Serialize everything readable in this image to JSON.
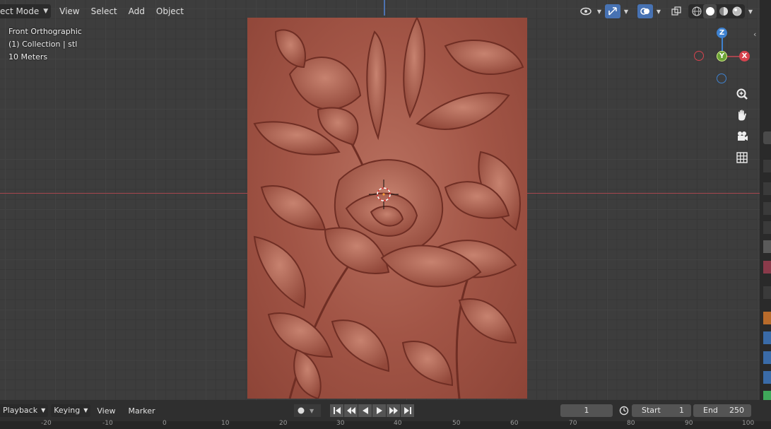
{
  "header": {
    "mode_label": "ect Mode",
    "menus": [
      "View",
      "Select",
      "Add",
      "Object"
    ]
  },
  "overlay": {
    "view_name": "Front Orthographic",
    "collection": "(1) Collection | stl",
    "scale": "10 Meters"
  },
  "gizmo": {
    "z": "Z",
    "y": "Y",
    "x": "X"
  },
  "timeline": {
    "playback_label": "Playback",
    "keying_label": "Keying",
    "view_label": "View",
    "marker_label": "Marker",
    "current_frame": "1",
    "start_label": "Start",
    "start_value": "1",
    "end_label": "End",
    "end_value": "250",
    "ruler_ticks": [
      "-20",
      "-10",
      "0",
      "10",
      "20",
      "30",
      "40",
      "50",
      "60",
      "70",
      "80",
      "90",
      "100"
    ]
  },
  "colors": {
    "x_axis": "#a5464e",
    "y_axis": "#6ba335",
    "z_axis": "#3f82d0",
    "active_button": "#4772b3",
    "relief": "#a25546"
  },
  "icons": [
    "visibility-icon",
    "gizmo-toggle-icon",
    "overlay-icon",
    "xray-icon",
    "wireframe-shading-icon",
    "solid-shading-icon",
    "material-shading-icon",
    "rendered-shading-icon",
    "zoom-icon",
    "pan-hand-icon",
    "camera-icon",
    "grid-icon",
    "record-icon",
    "jump-start-icon",
    "prev-keyframe-icon",
    "play-reverse-icon",
    "play-icon",
    "next-keyframe-icon",
    "jump-end-icon",
    "clock-icon"
  ]
}
